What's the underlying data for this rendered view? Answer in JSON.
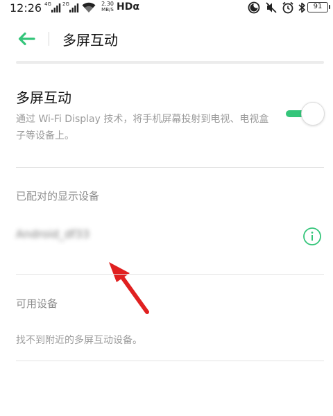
{
  "status_bar": {
    "time": "12:26",
    "sim1_tag": "4G",
    "sim2_tag": "2G",
    "net_speed_value": "2.30",
    "net_speed_unit": "MB/S",
    "hd_label": "HDα",
    "battery": "91",
    "icons": [
      "signal-icon",
      "signal-icon",
      "wifi-icon",
      "do-not-disturb-icon",
      "mute-icon",
      "alarm-icon",
      "bluetooth-icon",
      "battery-icon"
    ]
  },
  "header": {
    "title": "多屏互动",
    "back_icon": "back-arrow-icon"
  },
  "toggle": {
    "title": "多屏互动",
    "description": "通过 Wi-Fi Display 技术，将手机屏幕投射到电视、电视盒子等设备上。",
    "enabled": true
  },
  "paired_section": {
    "label": "已配对的显示设备",
    "devices": [
      {
        "name": "Android_df33",
        "info_icon": "info-icon"
      }
    ]
  },
  "available_section": {
    "label": "可用设备",
    "empty_text": "找不到附近的多屏互动设备。"
  },
  "colors": {
    "accent": "#34c57a",
    "arrow": "#e02020",
    "secondary_text": "#9b9b9b"
  }
}
